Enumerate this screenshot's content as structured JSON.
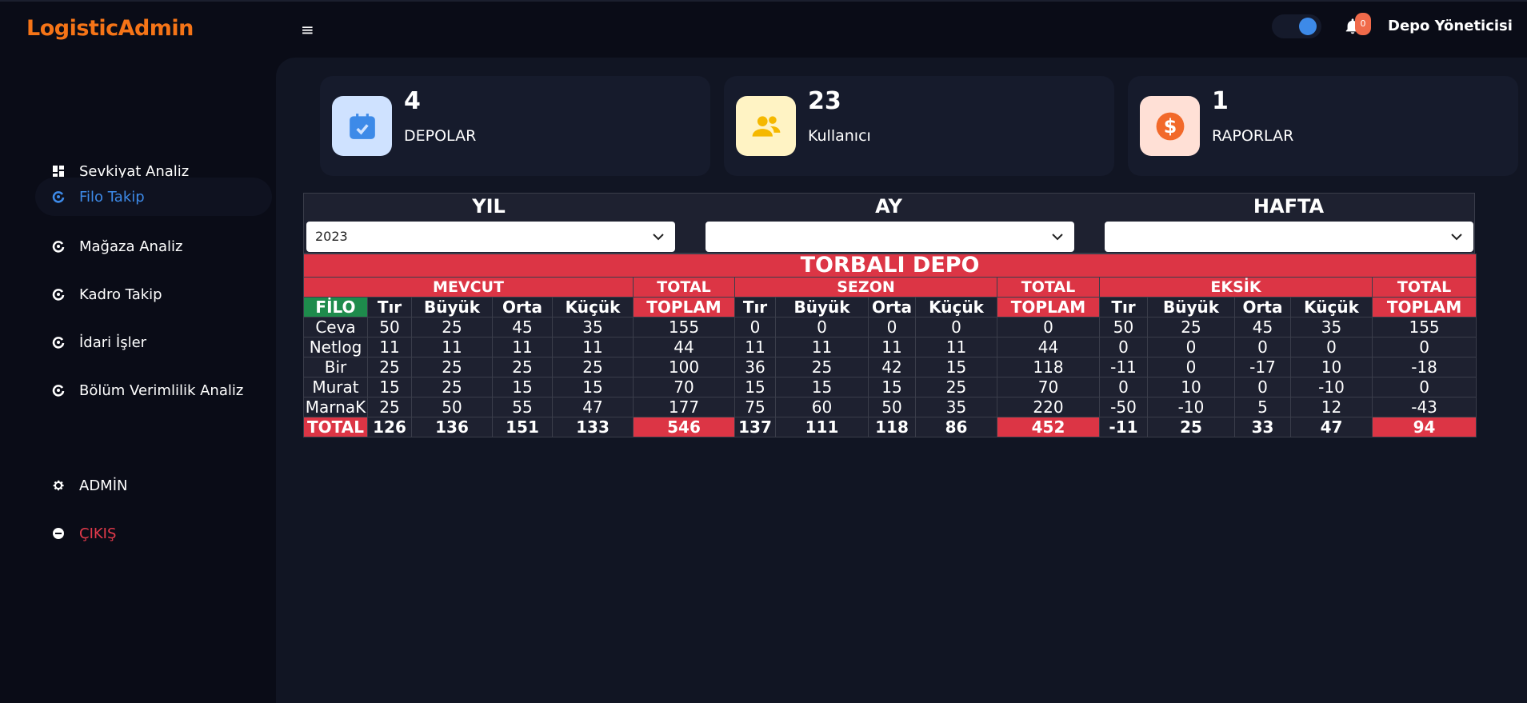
{
  "app": {
    "brand": "LogisticAdmin",
    "brand_color": "#f57417",
    "accent": "#3d8ae8",
    "danger": "#dc3545"
  },
  "header": {
    "menu_icon": "hamburger-icon",
    "notifications_count": "0",
    "user_name": "Depo Yöneticisi"
  },
  "sidebar": {
    "items": [
      {
        "label": "Sevkiyat Analiz",
        "icon": "dashboard-icon"
      },
      {
        "label": "Filo Takip",
        "icon": "circle-icon",
        "active": true
      },
      {
        "label": "Mağaza Analiz",
        "icon": "circle-icon"
      },
      {
        "label": "Kadro Takip",
        "icon": "circle-icon"
      },
      {
        "label": "İdari İşler",
        "icon": "circle-icon"
      },
      {
        "label": "Bölüm Verimlilik Analiz",
        "icon": "circle-icon"
      }
    ],
    "admin": {
      "label": "ADMİN",
      "icon": "gear-icon"
    },
    "logout": {
      "label": "ÇIKIŞ",
      "icon": "minus-circle-icon"
    }
  },
  "stats": [
    {
      "value": "4",
      "label": "DEPOLAR",
      "icon": "calendar-check-icon",
      "icon_bg": "#cfe2ff",
      "icon_color": "#3d8ae8"
    },
    {
      "value": "23",
      "label": "Kullanıcı",
      "icon": "users-icon",
      "icon_bg": "#fff3c4",
      "icon_color": "#f5b800"
    },
    {
      "value": "1",
      "label": "RAPORLAR",
      "icon": "dollar-icon",
      "icon_bg": "#ffe0d6",
      "icon_color": "#f2692a"
    }
  ],
  "filters": {
    "year": {
      "title": "YIL",
      "value": "2023"
    },
    "month": {
      "title": "AY",
      "value": ""
    },
    "week": {
      "title": "HAFTA",
      "value": ""
    }
  },
  "report": {
    "title": "TORBALI DEPO",
    "groups": {
      "current": "MEVCUT",
      "season": "SEZON",
      "missing": "EKSİK",
      "total": "TOTAL"
    },
    "columns": {
      "fleet": "FİLO",
      "c1": "Tır",
      "c2": "Büyük",
      "c3": "Orta",
      "c4": "Küçük",
      "sum": "TOPLAM"
    },
    "rows": [
      {
        "name": "Ceva",
        "values": [
          "50",
          "25",
          "45",
          "35",
          "155",
          "0",
          "0",
          "0",
          "0",
          "0",
          "50",
          "25",
          "45",
          "35",
          "155"
        ]
      },
      {
        "name": "Netlog",
        "values": [
          "11",
          "11",
          "11",
          "11",
          "44",
          "11",
          "11",
          "11",
          "11",
          "44",
          "0",
          "0",
          "0",
          "0",
          "0"
        ]
      },
      {
        "name": "Bir",
        "values": [
          "25",
          "25",
          "25",
          "25",
          "100",
          "36",
          "25",
          "42",
          "15",
          "118",
          "-11",
          "0",
          "-17",
          "10",
          "-18"
        ]
      },
      {
        "name": "Murat",
        "values": [
          "15",
          "25",
          "15",
          "15",
          "70",
          "15",
          "15",
          "15",
          "25",
          "70",
          "0",
          "10",
          "0",
          "-10",
          "0"
        ]
      },
      {
        "name": "MarnaK",
        "values": [
          "25",
          "50",
          "55",
          "47",
          "177",
          "75",
          "60",
          "50",
          "35",
          "220",
          "-50",
          "-10",
          "5",
          "12",
          "-43"
        ]
      }
    ],
    "total": {
      "name": "TOTAL",
      "values": [
        "126",
        "136",
        "151",
        "133",
        "546",
        "137",
        "111",
        "118",
        "86",
        "452",
        "-11",
        "25",
        "33",
        "47",
        "94"
      ]
    }
  }
}
